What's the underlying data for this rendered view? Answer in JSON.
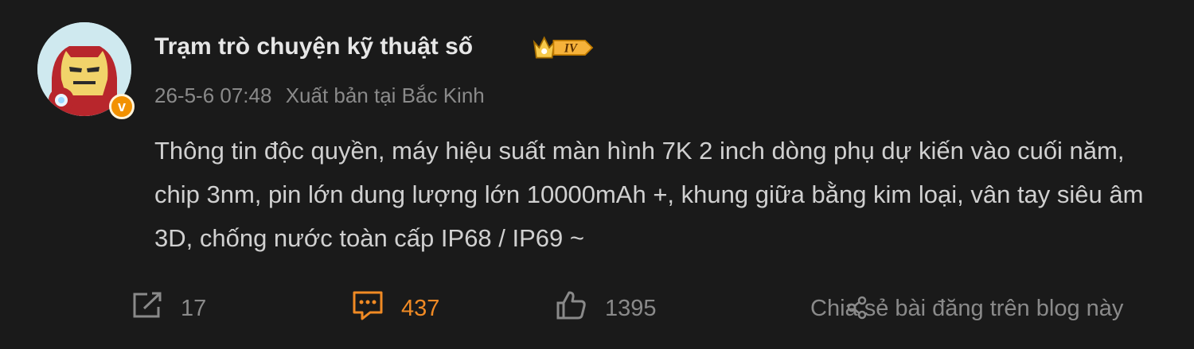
{
  "post": {
    "author": "Trạm trò chuyện kỹ thuật số",
    "level_badge": "IV",
    "timestamp": "26-5-6 07:48",
    "location": "Xuất bản tại Bắc Kinh",
    "content": "Thông tin độc quyền, máy hiệu suất màn hình 7K 2 inch dòng phụ dự kiến vào cuối năm, chip 3nm, pin lớn dung lượng lớn 10000mAh +, khung giữa bằng kim loại, vân tay siêu âm 3D, chống nước toàn cấp IP68 / IP69 ~"
  },
  "avatar": {
    "icon": "iron-man-avatar",
    "verified_mark": "v"
  },
  "actions": {
    "repost_count": "17",
    "comment_count": "437",
    "like_count": "1395",
    "share_blog_label": "Chia sẻ bài đăng trên blog này"
  },
  "colors": {
    "background": "#1a1a1a",
    "accent_comment": "#f08a24",
    "verified": "#f29100",
    "muted": "#8a8a8a"
  }
}
